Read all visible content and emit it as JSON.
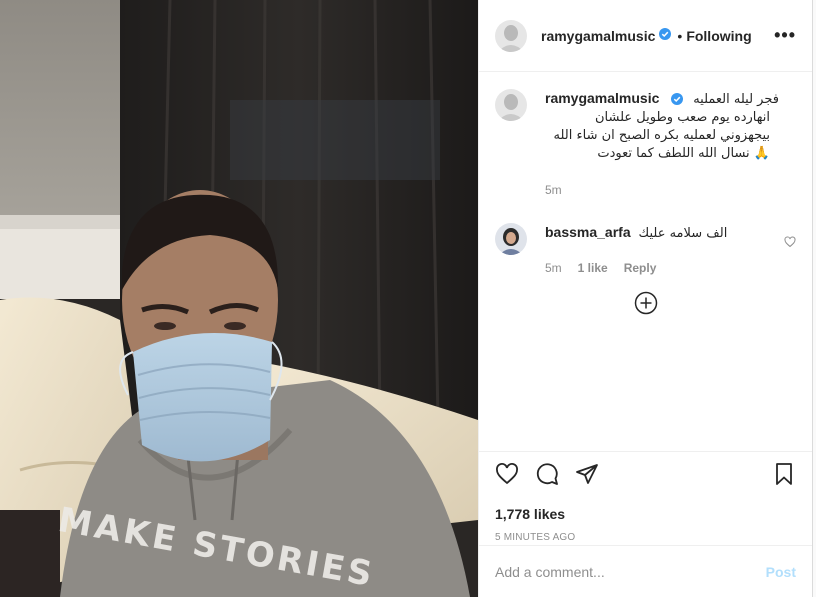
{
  "post": {
    "overlay_text": "MAKE STORIES",
    "header": {
      "username": "ramygamalmusic",
      "separator": "•",
      "follow_label": "Following",
      "more": "•••"
    },
    "caption": {
      "username": "ramygamalmusic",
      "lines": [
        "فجر ليله العمليه",
        "انهارده يوم صعب وطويل علشان",
        "بيجهزوني لعمليه بكره الصبح ان شاء الله",
        "🙏 نسال الله اللطف كما تعودت"
      ],
      "time": "5m"
    },
    "comments": [
      {
        "username": "bassma_arfa",
        "text": "الف سلامه عليك",
        "time": "5m",
        "likes": "1 like",
        "reply": "Reply"
      }
    ],
    "likes": "1,778 likes",
    "timestamp": "5 MINUTES AGO",
    "add_comment": {
      "placeholder": "Add a comment...",
      "post_label": "Post"
    }
  },
  "colors": {
    "verified": "#3897f0",
    "post_disabled": "#b2dffc",
    "muted": "#8e8e8e",
    "text": "#262626"
  },
  "icons": [
    "verified-badge-icon",
    "more-options-icon",
    "heart-icon",
    "comment-icon",
    "share-icon",
    "bookmark-icon",
    "plus-circle-icon"
  ]
}
